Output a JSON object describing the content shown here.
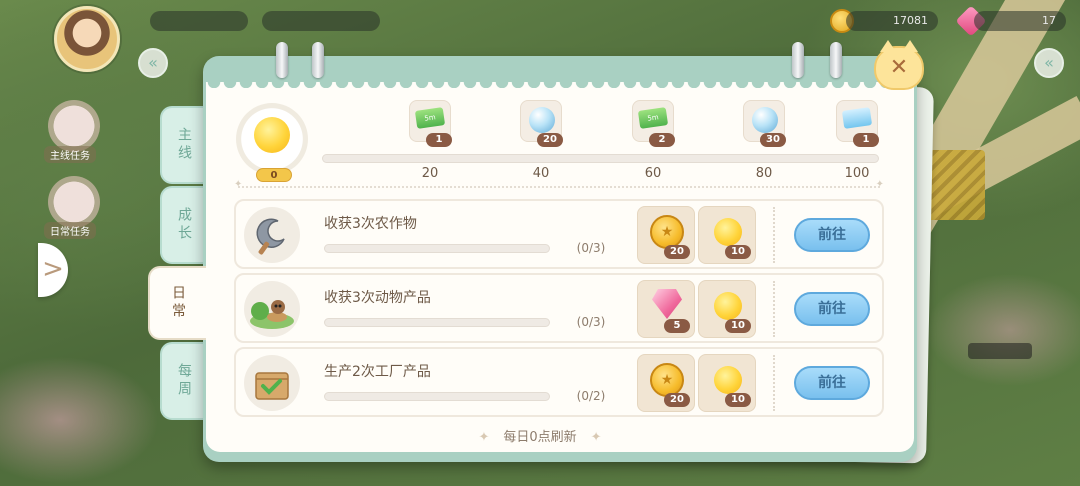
{
  "hud": {
    "coins": "17081",
    "gems": "17"
  },
  "side_panel": {
    "badge_1_label": "主线任务",
    "badge_2_label": "日常任务"
  },
  "modal": {
    "tabs": [
      {
        "label": "主线",
        "active": false
      },
      {
        "label": "成长",
        "active": false
      },
      {
        "label": "日常",
        "active": true
      },
      {
        "label": "每周",
        "active": false
      }
    ],
    "close_label": "✕",
    "activity": {
      "current": "0",
      "progress_fraction": 0,
      "milestones": [
        {
          "value": "20",
          "reward": "ticket-5m",
          "count": "1"
        },
        {
          "value": "40",
          "reward": "pearl",
          "count": "20"
        },
        {
          "value": "60",
          "reward": "ticket-5m",
          "count": "2"
        },
        {
          "value": "80",
          "reward": "pearl",
          "count": "30"
        },
        {
          "value": "100",
          "reward": "ticket-blue",
          "count": "1"
        }
      ]
    },
    "tasks": [
      {
        "title": "收获3次农作物",
        "progress": "(0/3)",
        "progress_fraction": 0,
        "icon": "sickle-icon",
        "rewards": [
          {
            "type": "coin",
            "count": "20"
          },
          {
            "type": "sun",
            "count": "10"
          }
        ],
        "button": "前往"
      },
      {
        "title": "收获3次动物产品",
        "progress": "(0/3)",
        "progress_fraction": 0,
        "icon": "animal-nest-icon",
        "rewards": [
          {
            "type": "gem",
            "count": "5"
          },
          {
            "type": "sun",
            "count": "10"
          }
        ],
        "button": "前往"
      },
      {
        "title": "生产2次工厂产品",
        "progress": "(0/2)",
        "progress_fraction": 0,
        "icon": "box-check-icon",
        "rewards": [
          {
            "type": "coin",
            "count": "20"
          },
          {
            "type": "sun",
            "count": "10"
          }
        ],
        "button": "前往"
      }
    ],
    "footer": "每日0点刷新"
  },
  "colors": {
    "accent_teal": "#a9d0c2",
    "button_blue": "#79c0ee",
    "progress_yellow": "#f6c54d",
    "badge_brown": "#8a5a44"
  }
}
